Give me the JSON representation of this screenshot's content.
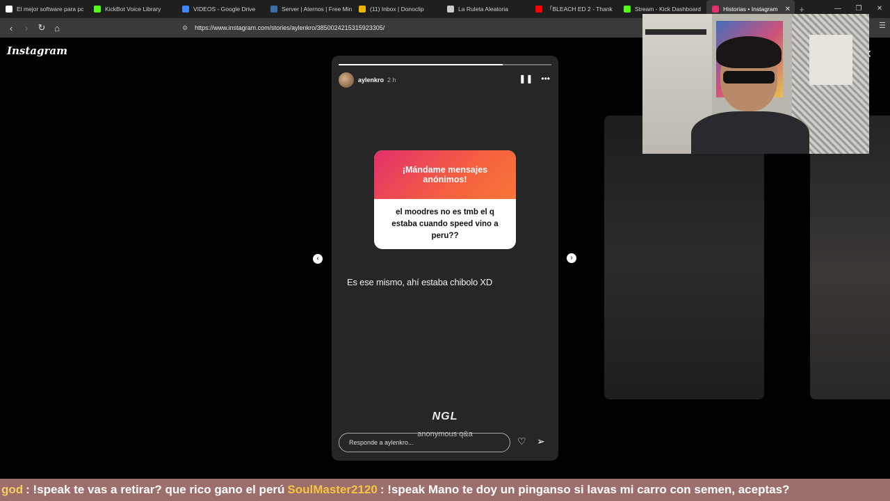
{
  "browser": {
    "tabs": [
      {
        "title": "El mejor software para pc",
        "color": "#ffffff"
      },
      {
        "title": "KickBot Voice Library",
        "color": "#53fc18"
      },
      {
        "title": "VIDEOS - Google Drive",
        "color": "#4285f4"
      },
      {
        "title": "Server | Aternos | Free Min",
        "color": "#3b6ea8"
      },
      {
        "title": "(11) Inbox | Donoclip",
        "color": "#f0b400"
      },
      {
        "title": "La Ruleta Aleatoria",
        "color": "#cccccc"
      },
      {
        "title": "「BLEACH ED 2 - Thank",
        "color": "#ff0000"
      },
      {
        "title": "Stream - Kick Dashboard",
        "color": "#53fc18"
      },
      {
        "title": "Historias • Instagram",
        "color": "#e1306c",
        "active": true
      }
    ],
    "url": "https://www.instagram.com/stories/aylenkro/3850024215315923305/"
  },
  "instagram": {
    "logo": "Instagram",
    "story": {
      "username": "aylenkro",
      "time": "2 h",
      "progress_fraction": 0.77,
      "question_title": "¡Mándame mensajes anónimos!",
      "question_text": "el moodres no es tmb el q estaba cuando speed vino a peru??",
      "answer_text": "Es ese mismo, ahí estaba chibolo XD",
      "ngl_brand": "NGL",
      "ngl_caption": "anonymous q&a",
      "reply_placeholder": "Responde a aylenkro..."
    }
  },
  "chat": {
    "user1": "god",
    "msg1": ": !speak te vas a retirar? que rico gano el perú",
    "user2": "SoulMaster2120",
    "msg2": ": !speak Mano te doy un pinganso si lavas mi carro con semen, aceptas?"
  }
}
